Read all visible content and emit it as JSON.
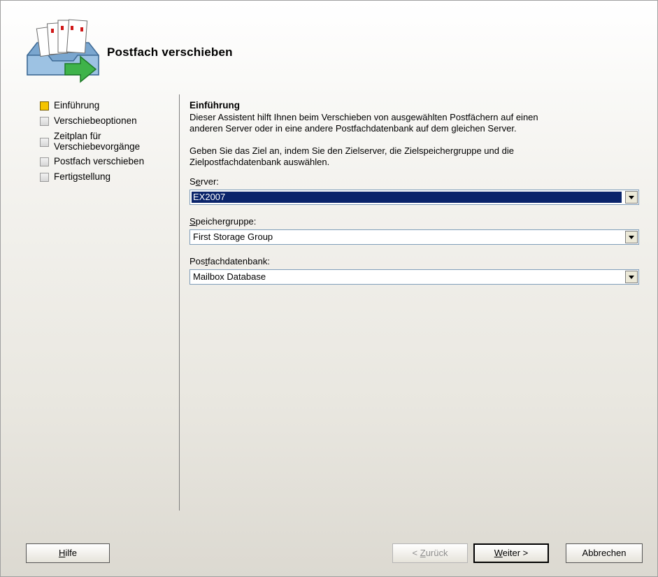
{
  "header": {
    "title": "Postfach verschieben",
    "icon": "mailbox-move-icon"
  },
  "steps": [
    {
      "label": "Einführung",
      "active": true
    },
    {
      "label": "Verschiebeoptionen",
      "active": false
    },
    {
      "label_line1": "Zeitplan für",
      "label_line2": "Verschiebevorgänge",
      "active": false
    },
    {
      "label": "Postfach verschieben",
      "active": false
    },
    {
      "label": "Fertigstellung",
      "active": false
    }
  ],
  "content": {
    "section_title": "Einführung",
    "para1_line1": "Dieser Assistent hilft Ihnen beim Verschieben von ausgewählten Postfächern auf einen",
    "para1_line2": "anderen Server oder in eine andere Postfachdatenbank auf dem gleichen Server.",
    "para2_line1": "Geben Sie das Ziel an, indem Sie den Zielserver, die Zielspeichergruppe und die",
    "para2_line2": "Zielpostfachdatenbank auswählen.",
    "server": {
      "label_pre": "S",
      "label_key": "e",
      "label_post": "rver:",
      "value": "EX2007"
    },
    "storage_group": {
      "label_key": "S",
      "label_post": "peichergruppe:",
      "value": "First Storage Group"
    },
    "database": {
      "label_pre": "Pos",
      "label_key": "t",
      "label_post": "fachdatenbank:",
      "value": "Mailbox Database"
    }
  },
  "buttons": {
    "help": {
      "key": "H",
      "rest": "ilfe"
    },
    "back": {
      "pre": "< ",
      "key": "Z",
      "rest": "urück"
    },
    "next": {
      "key": "W",
      "rest": "eiter >"
    },
    "cancel": "Abbrechen"
  },
  "colors": {
    "selection": "#0a246a",
    "active_step": "#f5c400"
  }
}
